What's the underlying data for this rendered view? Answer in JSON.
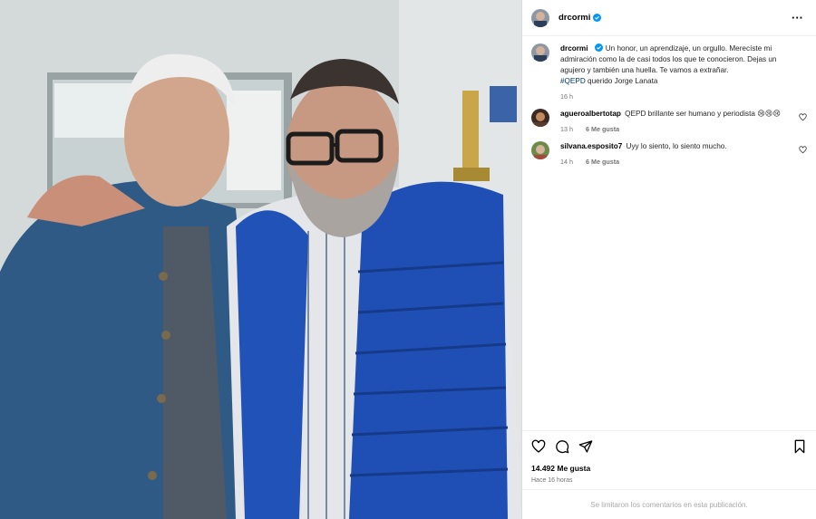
{
  "post": {
    "username": "drcormi",
    "caption": {
      "username": "drcormi",
      "text": "Un honor, un aprendizaje, un orgullo. Merecíste mi admiración como la de casi todos los que te conocieron. Dejas un agujero y también una huella. Te vamos a extrañar.",
      "hashtag": "#QEPD",
      "text_after": "querido Jorge Lanata",
      "time": "16 h"
    },
    "comments": [
      {
        "username": "agueroalbertotap",
        "text": "QEPD brillante ser humano y periodista 😢😢😢",
        "time": "13 h",
        "likes": "6 Me gusta"
      },
      {
        "username": "silvana.esposito7",
        "text": "Uyy lo siento, lo siento mucho.",
        "time": "14 h",
        "likes": "6 Me gusta"
      }
    ],
    "like_count": "14.492 Me gusta",
    "posted_ago": "Hace 16 horas",
    "comments_limited": "Se limitaron los comentarios en esta publicación.",
    "icons": {
      "more": "more-options-icon",
      "like": "heart-icon",
      "comment": "comment-icon",
      "share": "share-icon",
      "save": "bookmark-icon",
      "verified": "verified-badge-icon"
    },
    "colors": {
      "verified": "#0095f6",
      "hashtag": "#00376b",
      "meta": "#737373"
    }
  }
}
